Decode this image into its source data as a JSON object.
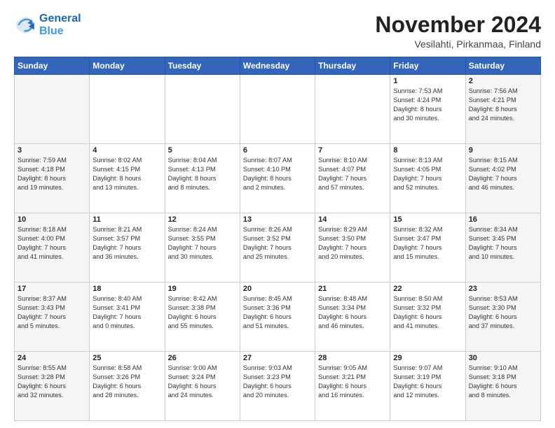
{
  "header": {
    "logo_line1": "General",
    "logo_line2": "Blue",
    "month": "November 2024",
    "location": "Vesilahti, Pirkanmaa, Finland"
  },
  "weekdays": [
    "Sunday",
    "Monday",
    "Tuesday",
    "Wednesday",
    "Thursday",
    "Friday",
    "Saturday"
  ],
  "weeks": [
    [
      {
        "day": "",
        "info": ""
      },
      {
        "day": "",
        "info": ""
      },
      {
        "day": "",
        "info": ""
      },
      {
        "day": "",
        "info": ""
      },
      {
        "day": "",
        "info": ""
      },
      {
        "day": "1",
        "info": "Sunrise: 7:53 AM\nSunset: 4:24 PM\nDaylight: 8 hours\nand 30 minutes."
      },
      {
        "day": "2",
        "info": "Sunrise: 7:56 AM\nSunset: 4:21 PM\nDaylight: 8 hours\nand 24 minutes."
      }
    ],
    [
      {
        "day": "3",
        "info": "Sunrise: 7:59 AM\nSunset: 4:18 PM\nDaylight: 8 hours\nand 19 minutes."
      },
      {
        "day": "4",
        "info": "Sunrise: 8:02 AM\nSunset: 4:15 PM\nDaylight: 8 hours\nand 13 minutes."
      },
      {
        "day": "5",
        "info": "Sunrise: 8:04 AM\nSunset: 4:13 PM\nDaylight: 8 hours\nand 8 minutes."
      },
      {
        "day": "6",
        "info": "Sunrise: 8:07 AM\nSunset: 4:10 PM\nDaylight: 8 hours\nand 2 minutes."
      },
      {
        "day": "7",
        "info": "Sunrise: 8:10 AM\nSunset: 4:07 PM\nDaylight: 7 hours\nand 57 minutes."
      },
      {
        "day": "8",
        "info": "Sunrise: 8:13 AM\nSunset: 4:05 PM\nDaylight: 7 hours\nand 52 minutes."
      },
      {
        "day": "9",
        "info": "Sunrise: 8:15 AM\nSunset: 4:02 PM\nDaylight: 7 hours\nand 46 minutes."
      }
    ],
    [
      {
        "day": "10",
        "info": "Sunrise: 8:18 AM\nSunset: 4:00 PM\nDaylight: 7 hours\nand 41 minutes."
      },
      {
        "day": "11",
        "info": "Sunrise: 8:21 AM\nSunset: 3:57 PM\nDaylight: 7 hours\nand 36 minutes."
      },
      {
        "day": "12",
        "info": "Sunrise: 8:24 AM\nSunset: 3:55 PM\nDaylight: 7 hours\nand 30 minutes."
      },
      {
        "day": "13",
        "info": "Sunrise: 8:26 AM\nSunset: 3:52 PM\nDaylight: 7 hours\nand 25 minutes."
      },
      {
        "day": "14",
        "info": "Sunrise: 8:29 AM\nSunset: 3:50 PM\nDaylight: 7 hours\nand 20 minutes."
      },
      {
        "day": "15",
        "info": "Sunrise: 8:32 AM\nSunset: 3:47 PM\nDaylight: 7 hours\nand 15 minutes."
      },
      {
        "day": "16",
        "info": "Sunrise: 8:34 AM\nSunset: 3:45 PM\nDaylight: 7 hours\nand 10 minutes."
      }
    ],
    [
      {
        "day": "17",
        "info": "Sunrise: 8:37 AM\nSunset: 3:43 PM\nDaylight: 7 hours\nand 5 minutes."
      },
      {
        "day": "18",
        "info": "Sunrise: 8:40 AM\nSunset: 3:41 PM\nDaylight: 7 hours\nand 0 minutes."
      },
      {
        "day": "19",
        "info": "Sunrise: 8:42 AM\nSunset: 3:38 PM\nDaylight: 6 hours\nand 55 minutes."
      },
      {
        "day": "20",
        "info": "Sunrise: 8:45 AM\nSunset: 3:36 PM\nDaylight: 6 hours\nand 51 minutes."
      },
      {
        "day": "21",
        "info": "Sunrise: 8:48 AM\nSunset: 3:34 PM\nDaylight: 6 hours\nand 46 minutes."
      },
      {
        "day": "22",
        "info": "Sunrise: 8:50 AM\nSunset: 3:32 PM\nDaylight: 6 hours\nand 41 minutes."
      },
      {
        "day": "23",
        "info": "Sunrise: 8:53 AM\nSunset: 3:30 PM\nDaylight: 6 hours\nand 37 minutes."
      }
    ],
    [
      {
        "day": "24",
        "info": "Sunrise: 8:55 AM\nSunset: 3:28 PM\nDaylight: 6 hours\nand 32 minutes."
      },
      {
        "day": "25",
        "info": "Sunrise: 8:58 AM\nSunset: 3:26 PM\nDaylight: 6 hours\nand 28 minutes."
      },
      {
        "day": "26",
        "info": "Sunrise: 9:00 AM\nSunset: 3:24 PM\nDaylight: 6 hours\nand 24 minutes."
      },
      {
        "day": "27",
        "info": "Sunrise: 9:03 AM\nSunset: 3:23 PM\nDaylight: 6 hours\nand 20 minutes."
      },
      {
        "day": "28",
        "info": "Sunrise: 9:05 AM\nSunset: 3:21 PM\nDaylight: 6 hours\nand 16 minutes."
      },
      {
        "day": "29",
        "info": "Sunrise: 9:07 AM\nSunset: 3:19 PM\nDaylight: 6 hours\nand 12 minutes."
      },
      {
        "day": "30",
        "info": "Sunrise: 9:10 AM\nSunset: 3:18 PM\nDaylight: 6 hours\nand 8 minutes."
      }
    ]
  ]
}
